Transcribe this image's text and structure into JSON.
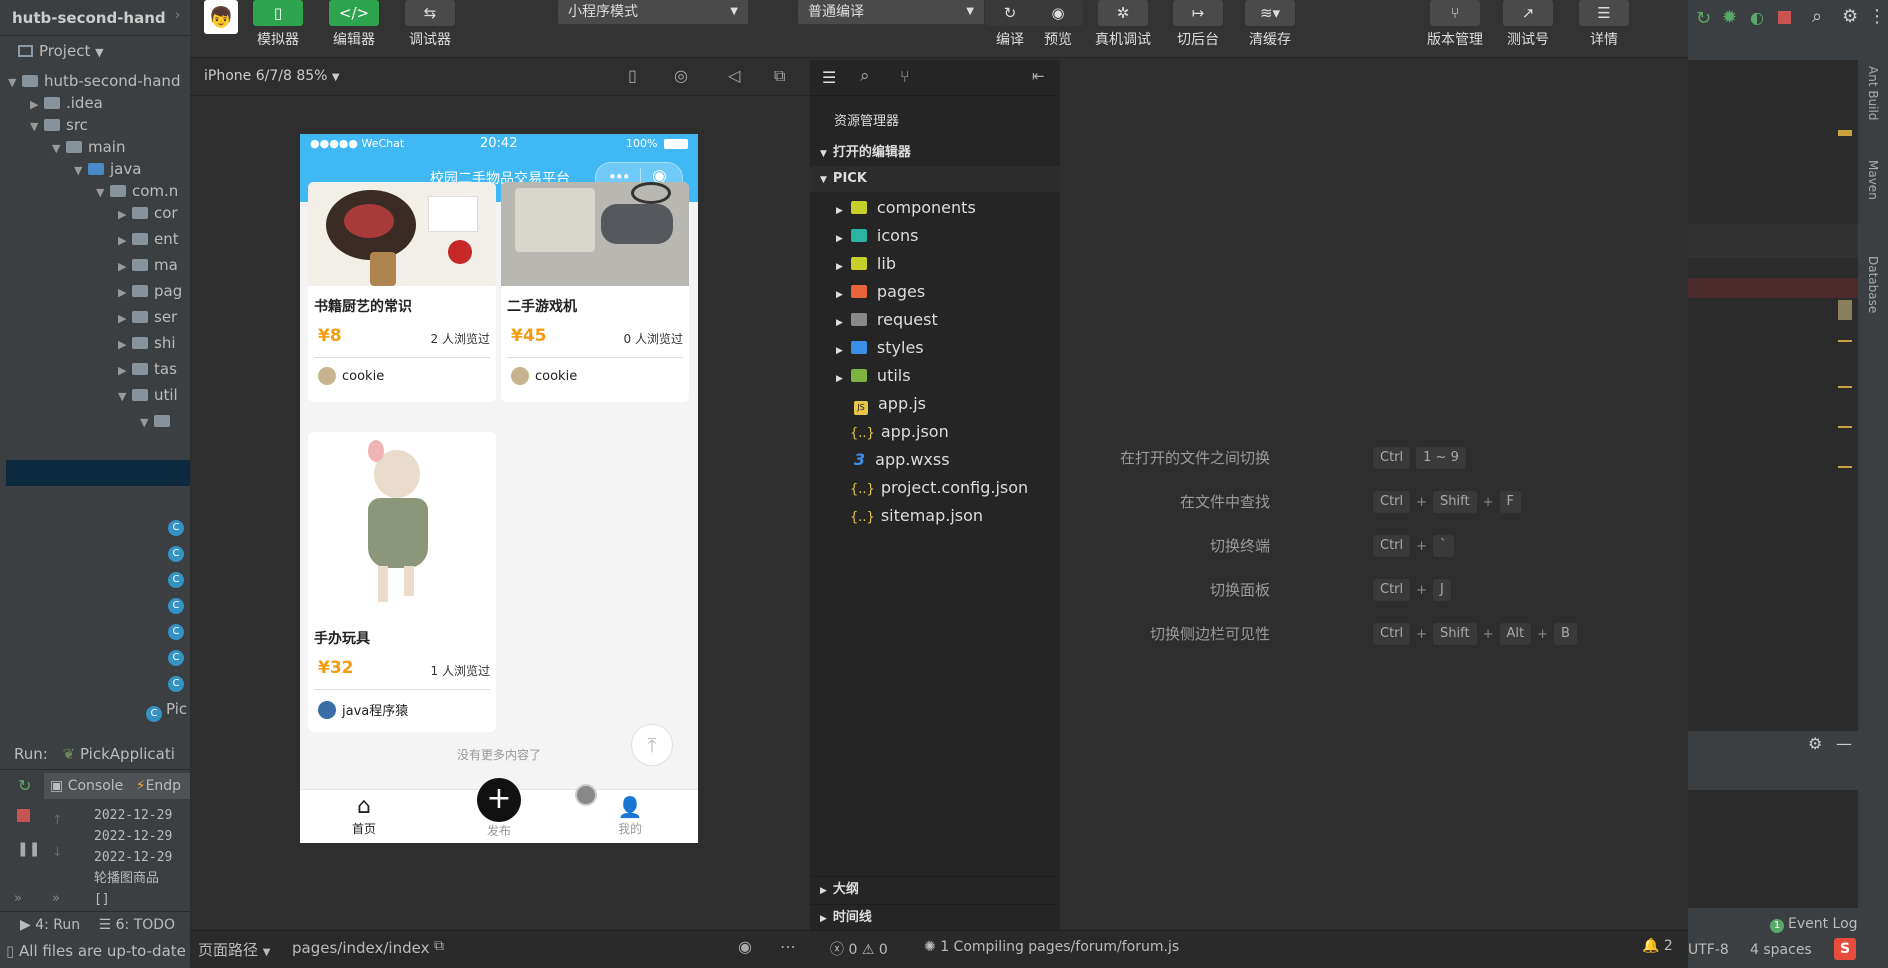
{
  "idea": {
    "project_name": "hutb-second-hand",
    "project_label": "Project",
    "tree": [
      {
        "label": "hutb-second-hand"
      },
      {
        "label": ".idea"
      },
      {
        "label": "src"
      },
      {
        "label": "main"
      },
      {
        "label": "java"
      },
      {
        "label": "com.n"
      },
      {
        "label": "cor"
      },
      {
        "label": "ent"
      },
      {
        "label": "ma"
      },
      {
        "label": "pag"
      },
      {
        "label": "ser"
      },
      {
        "label": "shi"
      },
      {
        "label": "tas"
      },
      {
        "label": "util"
      }
    ],
    "pick_label": "Pic",
    "run_label": "Run:",
    "run_config": "PickApplicati",
    "console_tab": "Console",
    "endpoints_tab": "Endp",
    "log_lines": [
      "2022-12-29",
      "2022-12-29",
      "2022-12-29",
      "轮播图商品",
      "[]"
    ],
    "run_tab": "4: Run",
    "todo_tab": "6: TODO",
    "status_msg": "All files are up-to-date (",
    "encoding": "UTF-8",
    "indent": "4 spaces",
    "event_log": "Event Log",
    "event_count": "1",
    "right_strip": [
      "Ant Build",
      "Maven",
      "Database"
    ]
  },
  "toolbar": {
    "simulator": "模拟器",
    "editor": "编辑器",
    "debugger": "调试器",
    "mode": "小程序模式",
    "compile_mode": "普通编译",
    "compile": "编译",
    "preview": "预览",
    "real_debug": "真机调试",
    "background": "切后台",
    "clear_cache": "清缓存",
    "version": "版本管理",
    "test": "测试号",
    "details": "详情"
  },
  "simulator": {
    "device": "iPhone 6/7/8 85%",
    "status_left": "●●●●● WeChat",
    "status_time": "20:42",
    "status_right": "100%",
    "nav_title": "校园二手物品交易平台",
    "no_more": "没有更多内容了",
    "cards": [
      {
        "title": "书籍厨艺的常识",
        "price": "¥8",
        "views": "2 人浏览过",
        "user": "cookie"
      },
      {
        "title": "二手游戏机",
        "price": "¥45",
        "views": "0 人浏览过",
        "user": "cookie"
      },
      {
        "title": "手办玩具",
        "price": "¥32",
        "views": "1 人浏览过",
        "user": "java程序猿"
      }
    ],
    "tabs": {
      "home": "首页",
      "publish": "发布",
      "mine": "我的"
    }
  },
  "explorer": {
    "title": "资源管理器",
    "open_editors": "打开的编辑器",
    "project": "PICK",
    "folders": [
      {
        "name": "components",
        "color": "#c5d12a"
      },
      {
        "name": "icons",
        "color": "#2bb3a3"
      },
      {
        "name": "lib",
        "color": "#c5d12a"
      },
      {
        "name": "pages",
        "color": "#e8643c"
      },
      {
        "name": "request",
        "color": "#888888"
      },
      {
        "name": "styles",
        "color": "#3c8ee8"
      },
      {
        "name": "utils",
        "color": "#7cb342"
      }
    ],
    "files": [
      {
        "name": "app.js",
        "icon": "JS",
        "color": "#e8c547"
      },
      {
        "name": "app.json",
        "icon": "{..}",
        "color": "#e8c547"
      },
      {
        "name": "app.wxss",
        "icon": "3",
        "color": "#3c8ee8"
      },
      {
        "name": "project.config.json",
        "icon": "{..}",
        "color": "#e8c547"
      },
      {
        "name": "sitemap.json",
        "icon": "{..}",
        "color": "#e8c547"
      }
    ],
    "outline": "大纲",
    "timeline": "时间线"
  },
  "shortcuts": [
    {
      "desc": "在打开的文件之间切换",
      "keys": [
        "Ctrl",
        "1 ~ 9"
      ]
    },
    {
      "desc": "在文件中查找",
      "keys": [
        "Ctrl",
        "Shift",
        "F"
      ]
    },
    {
      "desc": "切换终端",
      "keys": [
        "Ctrl",
        "`"
      ]
    },
    {
      "desc": "切换面板",
      "keys": [
        "Ctrl",
        "J"
      ]
    },
    {
      "desc": "切换侧边栏可见性",
      "keys": [
        "Ctrl",
        "Shift",
        "Alt",
        "B"
      ]
    }
  ],
  "bottom": {
    "page_path_label": "页面路径",
    "page_path": "pages/index/index",
    "errors": "0",
    "warnings": "0",
    "compiling": "1 Compiling pages/forum/forum.js",
    "notifications": "2"
  }
}
